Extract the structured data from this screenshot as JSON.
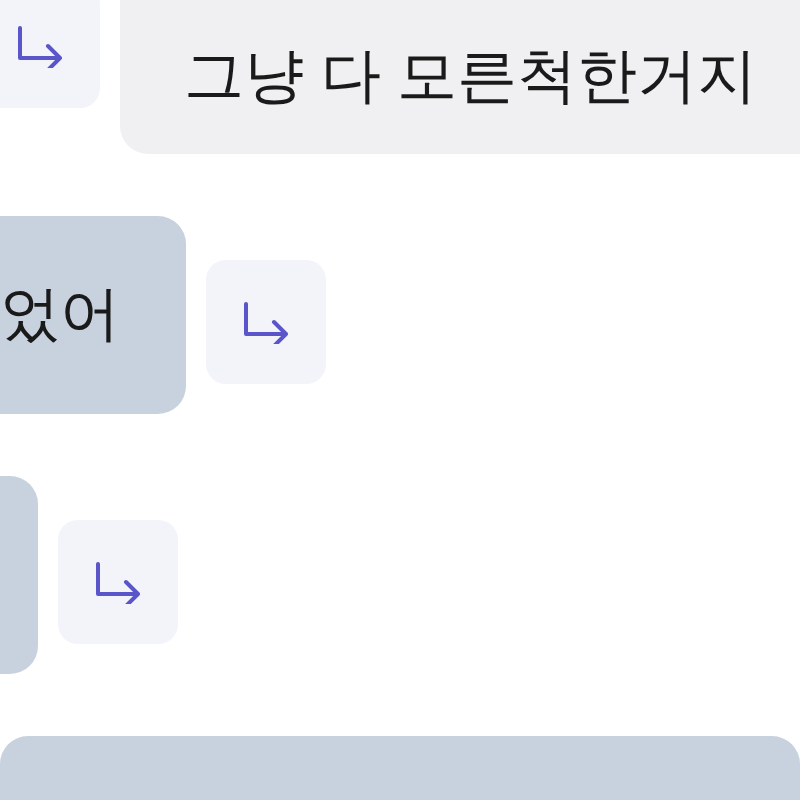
{
  "messages": [
    {
      "kind": "received",
      "text": "그냥 다 모른척한거지",
      "reply_icon": true
    },
    {
      "kind": "sent",
      "text": "었어",
      "reply_icon": true
    },
    {
      "kind": "sent",
      "reply_icon": true
    },
    {
      "kind": "sent",
      "reply_icon": false
    }
  ]
}
